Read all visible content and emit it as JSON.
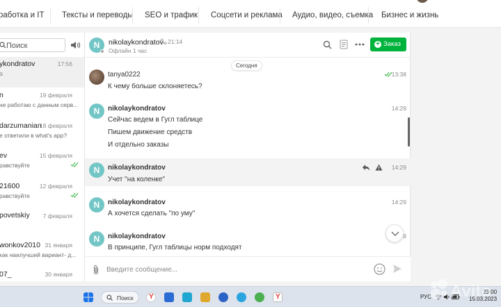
{
  "topnav": {
    "categories": [
      "работка и IT",
      "Тексты и переводы",
      "SEO и трафик",
      "Соцсети и реклама",
      "Аудио, видео, съемка",
      "Бизнес и жизнь"
    ]
  },
  "sidebar": {
    "search_placeholder": "Поиск",
    "chats": [
      {
        "name": "ykondratov",
        "date": "17:56",
        "preview": "o",
        "active": true,
        "read": false
      },
      {
        "name": "n",
        "date": "19 февраля",
        "preview": "не работаю с данным серв...",
        "active": false,
        "read": false
      },
      {
        "name": "darzumanian",
        "date": "18 февраля",
        "preview": "е ответили в what's app?",
        "active": false,
        "read": false
      },
      {
        "name": "ev",
        "date": "15 февраля",
        "preview": "равствуйте",
        "active": false,
        "read": true
      },
      {
        "name": "21600",
        "date": "12 февраля",
        "preview": "равствуйте",
        "active": false,
        "read": true
      },
      {
        "name": "povetskiy",
        "date": "7 февраля",
        "preview": "",
        "active": false,
        "read": false
      },
      {
        "name": "wonkov2010",
        "date": "31 января",
        "preview": "как наилучший вариант- д...",
        "active": false,
        "read": false
      },
      {
        "name": "07_",
        "date": "30 января",
        "preview": "",
        "active": false,
        "read": false
      }
    ]
  },
  "chat": {
    "header": {
      "avatar_letter": "N",
      "name": "nikolaykondratov",
      "local_time": "21:14",
      "status": "Офлайн 1 час",
      "order_label": "Заказ"
    },
    "day_label": "Сегодня",
    "messages": {
      "m1": {
        "author": "tanya0222",
        "time": "13:38",
        "lines": [
          "К чему больше склоняетесь?"
        ]
      },
      "m2": {
        "avatar": "N",
        "author": "nikolaykondratov",
        "time": "14:29",
        "lines": [
          "Сейчас ведем в Гугл таблице",
          "Пишем движение средств",
          "И отдельно заказы"
        ]
      },
      "m3": {
        "avatar": "N",
        "author": "nikolaykondratov",
        "time": "14:29",
        "lines": [
          "Учет \"на коленке\""
        ]
      },
      "m4": {
        "avatar": "N",
        "author": "nikolaykondratov",
        "time": "14:29",
        "lines": [
          "А хочется сделать \"по уму\""
        ]
      },
      "m5": {
        "avatar": "N",
        "author": "nikolaykondratov",
        "time": "14:29",
        "lines": [
          "В принципе, Гугл таблицы норм подходят"
        ]
      }
    },
    "composer_placeholder": "Введите сообщение..."
  },
  "taskbar": {
    "search_label": "Поиск",
    "lang": "РУС",
    "time": "23:00",
    "date": "15.03.2023"
  },
  "colors": {
    "accent_green": "#00b33c",
    "avatar_teal": "#73c6c6",
    "read_check": "#3cb84a"
  }
}
